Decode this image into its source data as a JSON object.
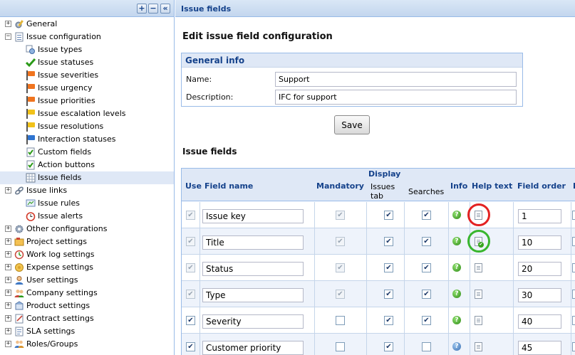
{
  "tree": {
    "toolbar": {
      "expand_label": "+",
      "collapse_label": "−",
      "hide_label": "«"
    },
    "nodes": [
      {
        "label": "General",
        "icon": "gear-pencil-icon",
        "expander": "+"
      },
      {
        "label": "Issue configuration",
        "icon": "list-document-icon",
        "expander": "−"
      },
      {
        "label": "Issue types",
        "icon": "issue-types-icon"
      },
      {
        "label": "Issue statuses",
        "icon": "green-check-icon"
      },
      {
        "label": "Issue severities",
        "icon": "orange-flag-icon"
      },
      {
        "label": "Issue urgency",
        "icon": "orange-flag-icon"
      },
      {
        "label": "Issue priorities",
        "icon": "orange-flag-icon"
      },
      {
        "label": "Issue escalation levels",
        "icon": "yellow-flag-icon"
      },
      {
        "label": "Issue resolutions",
        "icon": "yellow-flag-icon"
      },
      {
        "label": "Interaction statuses",
        "icon": "blue-flag-icon"
      },
      {
        "label": "Custom fields",
        "icon": "check-document-icon"
      },
      {
        "label": "Action buttons",
        "icon": "check-document-icon"
      },
      {
        "label": "Issue fields",
        "icon": "grid-icon"
      },
      {
        "label": "Issue links",
        "icon": "link-icon",
        "expander": "+"
      },
      {
        "label": "Issue rules",
        "icon": "rules-icon"
      },
      {
        "label": "Issue alerts",
        "icon": "alarm-clock-icon"
      },
      {
        "label": "Other configurations",
        "icon": "gear-icon",
        "expander": "+"
      },
      {
        "label": "Project settings",
        "icon": "project-icon",
        "expander": "+"
      },
      {
        "label": "Work log settings",
        "icon": "worklog-icon",
        "expander": "+"
      },
      {
        "label": "Expense settings",
        "icon": "expense-icon",
        "expander": "+"
      },
      {
        "label": "User settings",
        "icon": "user-icon",
        "expander": "+"
      },
      {
        "label": "Company settings",
        "icon": "company-icon",
        "expander": "+"
      },
      {
        "label": "Product settings",
        "icon": "product-icon",
        "expander": "+"
      },
      {
        "label": "Contract settings",
        "icon": "contract-icon",
        "expander": "+"
      },
      {
        "label": "SLA settings",
        "icon": "sla-icon",
        "expander": "+"
      },
      {
        "label": "Roles/Groups",
        "icon": "roles-icon",
        "expander": "+"
      }
    ]
  },
  "panel": {
    "title": "Issue fields"
  },
  "form": {
    "heading": "Edit issue field configuration",
    "general_info": {
      "title": "General info",
      "name_label": "Name:",
      "name_value": "Support",
      "description_label": "Description:",
      "description_value": "IFC for support"
    },
    "save_label": "Save"
  },
  "issue_fields": {
    "heading": "Issue fields",
    "columns": {
      "display": "Display",
      "use": "Use",
      "field_name": "Field name",
      "mandatory": "Mandatory",
      "issues_tab_line1": "Issues",
      "issues_tab_line2": "tab",
      "searches": "Searches",
      "info": "Info",
      "help_text": "Help text",
      "field_order": "Field order",
      "next_col_fragment": "I"
    },
    "rows": [
      {
        "name": "Issue key",
        "use": true,
        "use_locked": true,
        "mandatory": true,
        "mandatory_locked": true,
        "issues_tab": true,
        "searches": true,
        "info_icon": "green-help-icon",
        "help_icon": "document-icon",
        "order": "1",
        "highlight": "red"
      },
      {
        "name": "Title",
        "use": true,
        "use_locked": true,
        "mandatory": true,
        "mandatory_locked": true,
        "issues_tab": true,
        "searches": true,
        "info_icon": "green-help-icon",
        "help_icon": "document-check-icon",
        "order": "10",
        "highlight": "green"
      },
      {
        "name": "Status",
        "use": true,
        "use_locked": true,
        "mandatory": true,
        "mandatory_locked": true,
        "issues_tab": true,
        "searches": true,
        "info_icon": "green-help-icon",
        "help_icon": "document-icon",
        "order": "20"
      },
      {
        "name": "Type",
        "use": true,
        "use_locked": true,
        "mandatory": true,
        "mandatory_locked": true,
        "issues_tab": true,
        "searches": true,
        "info_icon": "green-help-icon",
        "help_icon": "document-icon",
        "order": "30"
      },
      {
        "name": "Severity",
        "use": true,
        "use_locked": false,
        "mandatory": false,
        "mandatory_locked": false,
        "issues_tab": true,
        "searches": true,
        "info_icon": "green-help-icon",
        "help_icon": "document-icon",
        "order": "40"
      },
      {
        "name": "Customer priority",
        "use": true,
        "use_locked": false,
        "mandatory": false,
        "mandatory_locked": false,
        "issues_tab": true,
        "searches": false,
        "info_icon": "blue-help-icon",
        "help_icon": "document-icon",
        "order": "45"
      }
    ]
  },
  "colors": {
    "header_blue": "#15428b",
    "panel_border": "#99bbe8",
    "highlight_red": "#e32222",
    "highlight_green": "#39b62e"
  }
}
